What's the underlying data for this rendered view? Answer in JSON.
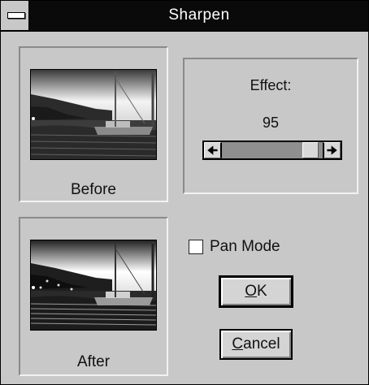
{
  "window": {
    "title": "Sharpen"
  },
  "preview": {
    "before_caption": "Before",
    "after_caption": "After"
  },
  "effect": {
    "label": "Effect:",
    "value": "95",
    "level": 0.95
  },
  "options": {
    "pan_mode_label": "Pan Mode",
    "pan_mode_checked": false
  },
  "buttons": {
    "ok": {
      "mnemonic": "O",
      "rest": "K"
    },
    "cancel": {
      "mnemonic": "C",
      "rest": "ancel"
    }
  },
  "icons": {
    "scroll_left": "left-arrow-icon",
    "scroll_right": "right-arrow-icon",
    "system_menu": "system-menu-icon"
  }
}
